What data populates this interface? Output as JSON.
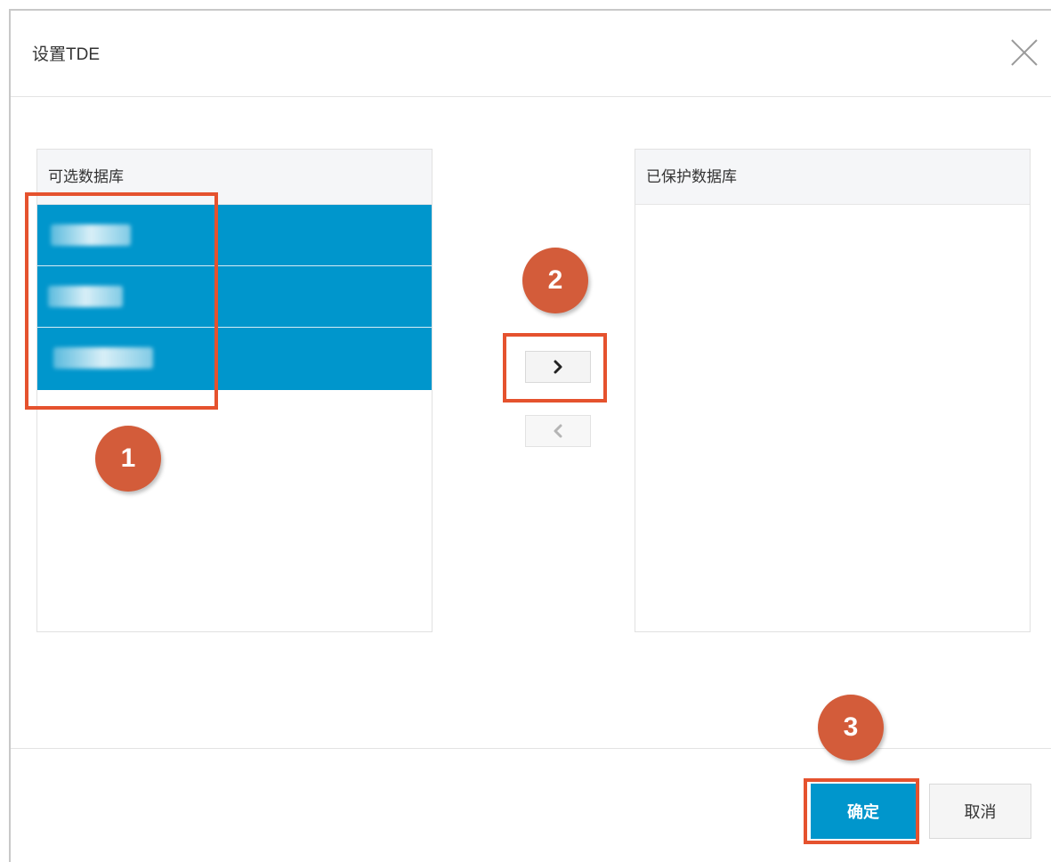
{
  "dialog": {
    "title": "设置TDE"
  },
  "available_panel": {
    "header": "可选数据库",
    "items": [
      "",
      "",
      ""
    ]
  },
  "protected_panel": {
    "header": "已保护数据库",
    "items": []
  },
  "transfer": {
    "add_icon": "chevron-right-icon",
    "remove_icon": "chevron-left-icon"
  },
  "footer": {
    "ok_label": "确定",
    "cancel_label": "取消"
  },
  "annotations": {
    "step1": "1",
    "step2": "2",
    "step3": "3"
  },
  "colors": {
    "accent": "#0096cc",
    "highlight": "#e5522e",
    "badge": "#d35c3a"
  }
}
